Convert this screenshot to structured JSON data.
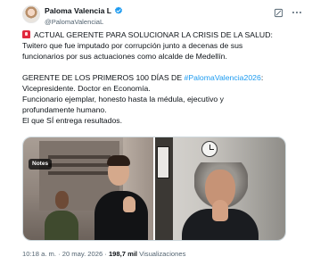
{
  "tweet": {
    "author": {
      "display_name": "Paloma Valencia L",
      "handle": "@PalomaValenciaL",
      "verified": true
    },
    "icons": {
      "verified": "verified-badge-icon",
      "grok": "grok-icon",
      "more": "more-options-icon",
      "siren": "rotating-light-emoji-icon"
    },
    "text": {
      "line1": "ACTUAL GERENTE PARA SOLUCIONAR LA CRISIS DE LA SALUD:",
      "line2": "Twitero que fue imputado por corrupción junto a decenas de sus",
      "line3": "funcionarios por sus actuaciones como alcalde de Medellín.",
      "line5_prefix": "GERENTE DE LOS PRIMEROS 100 DÍAS DE ",
      "hashtag": "#PalomaValencia2026",
      "line5_suffix": ":",
      "line6": "Vicepresidente. Doctor en Economía.",
      "line7": "Funcionario ejemplar, honesto hasta la médula, ejecutivo y",
      "line8": "profundamente humano.",
      "line9": "El que SÍ entrega resultados."
    },
    "media": {
      "notes_label": "Notes"
    },
    "meta": {
      "time": "10:18 a. m.",
      "separator": " · ",
      "date": "20 may. 2026",
      "views_count": "198,7 mil",
      "views_label": " Visualizaciones"
    },
    "colors": {
      "text": "#0f1419",
      "secondary": "#536471",
      "link": "#1d9bf0",
      "verified": "#1d9bf0",
      "border": "#cfd9de"
    }
  }
}
